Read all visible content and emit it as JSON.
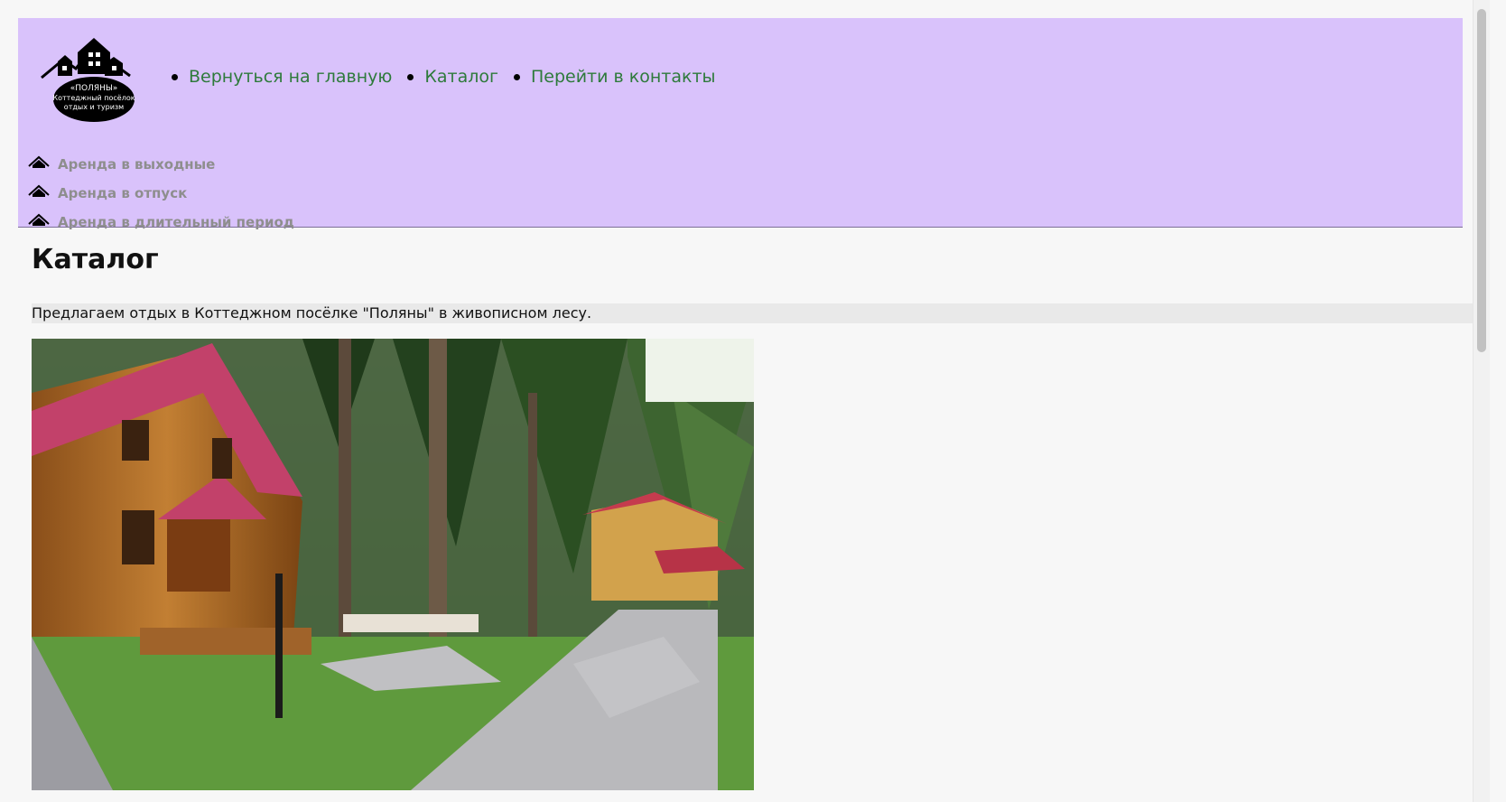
{
  "header": {
    "logo": {
      "line1": "«ПОЛЯНЫ»",
      "line2": "Коттеджный посёлок",
      "line3": "отдых и туризм"
    },
    "nav": [
      {
        "label": "Вернуться на главную"
      },
      {
        "label": "Каталог"
      },
      {
        "label": "Перейти в контакты"
      }
    ],
    "subnav": [
      {
        "label": "Аренда в выходные"
      },
      {
        "label": "Аренда в отпуск"
      },
      {
        "label": "Аренда в длительный период"
      }
    ]
  },
  "main": {
    "title": "Каталог",
    "intro": "Предлагаем отдых в Коттеджном посёлке \"Поляны\" в живописном лесу."
  },
  "colors": {
    "header_bg": "#d9c2fb",
    "nav_link": "#2e7a3b",
    "subnav_link": "#8e8e8e",
    "page_bg": "#f7f7f7"
  }
}
